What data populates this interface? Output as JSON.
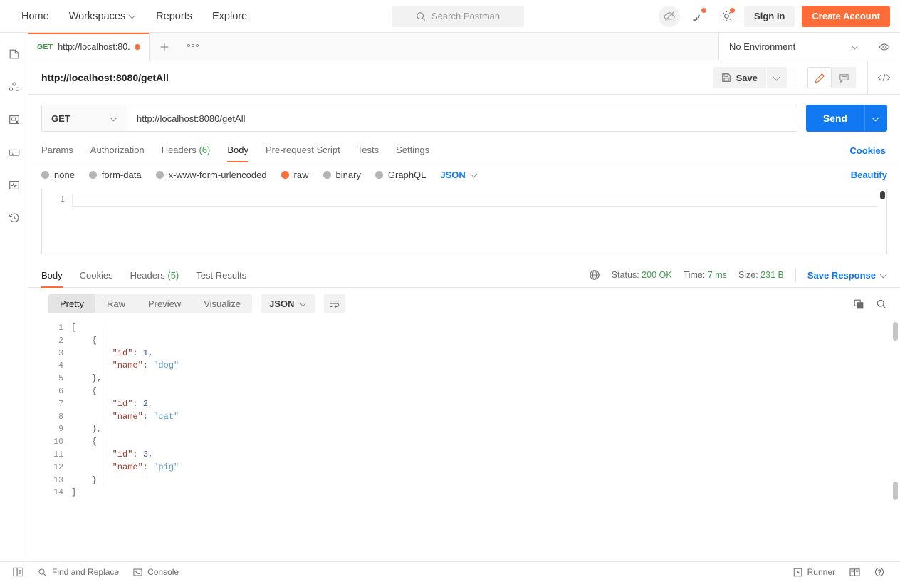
{
  "topnav": {
    "links": [
      {
        "label": "Home",
        "icon": null
      },
      {
        "label": "Workspaces",
        "icon": "chevron-down-icon"
      },
      {
        "label": "Reports",
        "icon": null
      },
      {
        "label": "Explore",
        "icon": null
      }
    ],
    "search": {
      "placeholder": "Search Postman",
      "icon": "search-icon"
    },
    "cloud_icon": "cloud-offline-icon",
    "invite_icon": "satellite-icon",
    "settings_icon": "gear-icon",
    "sign_in_label": "Sign In",
    "create_account_label": "Create Account"
  },
  "sidebar": {
    "items": [
      {
        "name": "collections",
        "icon": "collections-icon"
      },
      {
        "name": "apis",
        "icon": "apis-icon"
      },
      {
        "name": "environments",
        "icon": "environments-icon"
      },
      {
        "name": "mock-servers",
        "icon": "mock-servers-icon"
      },
      {
        "name": "monitors",
        "icon": "monitors-icon"
      },
      {
        "name": "history",
        "icon": "history-icon"
      }
    ]
  },
  "tabstrip": {
    "tab": {
      "method": "GET",
      "name": "http://localhost:80...",
      "unsaved": true
    },
    "new_tab_icon": "plus-icon",
    "more_icon": "ellipsis-icon",
    "environment": {
      "value": "No Environment",
      "icon": "chevron-down-icon"
    },
    "eye_icon": "eye-icon"
  },
  "titlebar": {
    "title": "http://localhost:8080/getAll",
    "save_label": "Save",
    "save_icon": "save-disk-icon",
    "save_caret_icon": "chevron-down-icon",
    "edit_icon": "pencil-icon",
    "comment_icon": "comment-icon",
    "code_icon": "code-snippet-icon"
  },
  "urlbar": {
    "method": "GET",
    "method_caret_icon": "chevron-down-icon",
    "url": "http://localhost:8080/getAll",
    "send_label": "Send",
    "send_caret_icon": "chevron-down-icon"
  },
  "request_tabs": {
    "items": [
      {
        "label": "Params",
        "count": null,
        "active": false
      },
      {
        "label": "Authorization",
        "count": null,
        "active": false
      },
      {
        "label": "Headers",
        "count": "(6)",
        "active": false
      },
      {
        "label": "Body",
        "count": null,
        "active": true
      },
      {
        "label": "Pre-request Script",
        "count": null,
        "active": false
      },
      {
        "label": "Tests",
        "count": null,
        "active": false
      },
      {
        "label": "Settings",
        "count": null,
        "active": false
      }
    ],
    "cookies_label": "Cookies"
  },
  "body_type": {
    "options": [
      {
        "label": "none",
        "selected": false
      },
      {
        "label": "form-data",
        "selected": false
      },
      {
        "label": "x-www-form-urlencoded",
        "selected": false
      },
      {
        "label": "raw",
        "selected": true
      },
      {
        "label": "binary",
        "selected": false
      },
      {
        "label": "GraphQL",
        "selected": false
      }
    ],
    "format": "JSON",
    "format_caret_icon": "chevron-down-icon",
    "beautify_label": "Beautify"
  },
  "request_editor": {
    "lines": [
      {
        "no": "1",
        "text": ""
      }
    ]
  },
  "response": {
    "tabs": [
      {
        "label": "Body",
        "count": null,
        "active": true
      },
      {
        "label": "Cookies",
        "count": null,
        "active": false
      },
      {
        "label": "Headers",
        "count": "(5)",
        "active": false
      },
      {
        "label": "Test Results",
        "count": null,
        "active": false
      }
    ],
    "globe_icon": "globe-icon",
    "status_label": "Status:",
    "status_value": "200 OK",
    "time_label": "Time:",
    "time_value": "7 ms",
    "size_label": "Size:",
    "size_value": "231 B",
    "save_response_label": "Save Response",
    "save_response_caret_icon": "chevron-down-icon",
    "view_modes": [
      {
        "label": "Pretty",
        "active": true
      },
      {
        "label": "Raw",
        "active": false
      },
      {
        "label": "Preview",
        "active": false
      },
      {
        "label": "Visualize",
        "active": false
      }
    ],
    "format": "JSON",
    "format_caret_icon": "chevron-down-icon",
    "wrap_icon": "word-wrap-icon",
    "copy_icon": "copy-icon",
    "search_icon": "search-icon",
    "body_lines": [
      {
        "no": "1",
        "tokens": [
          {
            "t": "[",
            "c": "p"
          }
        ]
      },
      {
        "no": "2",
        "tokens": [
          {
            "t": "    {",
            "c": "p"
          }
        ]
      },
      {
        "no": "3",
        "tokens": [
          {
            "t": "        ",
            "c": "p"
          },
          {
            "t": "\"id\"",
            "c": "k"
          },
          {
            "t": ": ",
            "c": "p"
          },
          {
            "t": "1",
            "c": "n"
          },
          {
            "t": ",",
            "c": "p"
          }
        ]
      },
      {
        "no": "4",
        "tokens": [
          {
            "t": "        ",
            "c": "p"
          },
          {
            "t": "\"name\"",
            "c": "k"
          },
          {
            "t": ": ",
            "c": "p"
          },
          {
            "t": "\"dog\"",
            "c": "s"
          }
        ]
      },
      {
        "no": "5",
        "tokens": [
          {
            "t": "    },",
            "c": "p"
          }
        ]
      },
      {
        "no": "6",
        "tokens": [
          {
            "t": "    {",
            "c": "p"
          }
        ]
      },
      {
        "no": "7",
        "tokens": [
          {
            "t": "        ",
            "c": "p"
          },
          {
            "t": "\"id\"",
            "c": "k"
          },
          {
            "t": ": ",
            "c": "p"
          },
          {
            "t": "2",
            "c": "n"
          },
          {
            "t": ",",
            "c": "p"
          }
        ]
      },
      {
        "no": "8",
        "tokens": [
          {
            "t": "        ",
            "c": "p"
          },
          {
            "t": "\"name\"",
            "c": "k"
          },
          {
            "t": ": ",
            "c": "p"
          },
          {
            "t": "\"cat\"",
            "c": "s"
          }
        ]
      },
      {
        "no": "9",
        "tokens": [
          {
            "t": "    },",
            "c": "p"
          }
        ]
      },
      {
        "no": "10",
        "tokens": [
          {
            "t": "    {",
            "c": "p"
          }
        ]
      },
      {
        "no": "11",
        "tokens": [
          {
            "t": "        ",
            "c": "p"
          },
          {
            "t": "\"id\"",
            "c": "k"
          },
          {
            "t": ": ",
            "c": "p"
          },
          {
            "t": "3",
            "c": "n"
          },
          {
            "t": ",",
            "c": "p"
          }
        ]
      },
      {
        "no": "12",
        "tokens": [
          {
            "t": "        ",
            "c": "p"
          },
          {
            "t": "\"name\"",
            "c": "k"
          },
          {
            "t": ": ",
            "c": "p"
          },
          {
            "t": "\"pig\"",
            "c": "s"
          }
        ]
      },
      {
        "no": "13",
        "tokens": [
          {
            "t": "    }",
            "c": "p"
          }
        ]
      },
      {
        "no": "14",
        "tokens": [
          {
            "t": "]",
            "c": "p"
          }
        ]
      }
    ]
  },
  "footer": {
    "sidebar_toggle_icon": "sidebar-toggle-icon",
    "find_replace_label": "Find and Replace",
    "find_replace_icon": "search-icon",
    "console_label": "Console",
    "console_icon": "terminal-icon",
    "runner_label": "Runner",
    "runner_icon": "play-box-icon",
    "layout_icon": "layout-icon",
    "help_icon": "help-icon"
  },
  "colors": {
    "accent": "#ff6c37",
    "link": "#1078f0",
    "success": "#3f9e4d",
    "send": "#1078f0"
  }
}
